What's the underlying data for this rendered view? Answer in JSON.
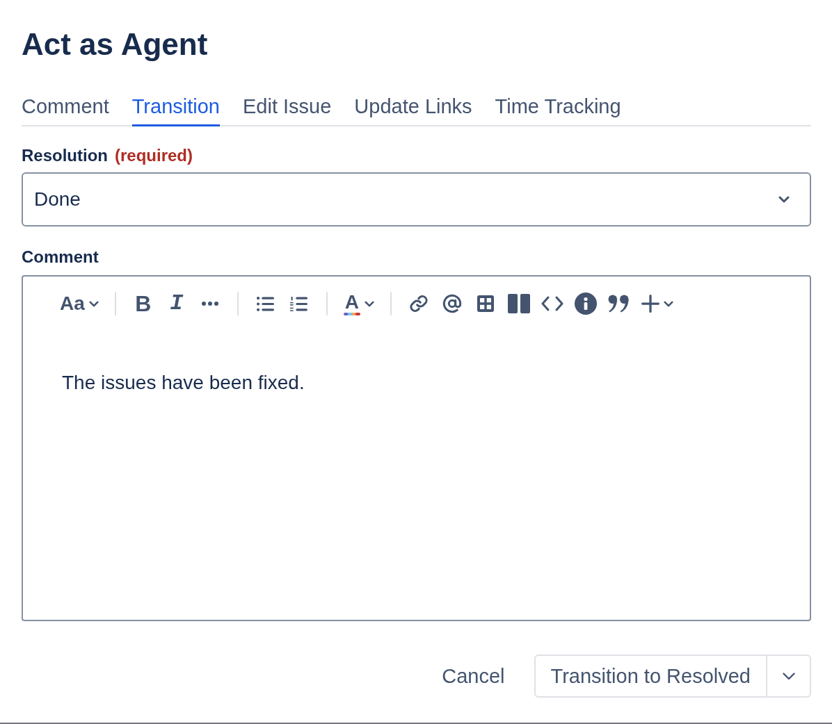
{
  "dialog": {
    "title": "Act as Agent"
  },
  "tabs": [
    {
      "label": "Comment",
      "selected": false
    },
    {
      "label": "Transition",
      "selected": true
    },
    {
      "label": "Edit Issue",
      "selected": false
    },
    {
      "label": "Update Links",
      "selected": false
    },
    {
      "label": "Time Tracking",
      "selected": false
    }
  ],
  "resolution": {
    "label": "Resolution",
    "required_note": "(required)",
    "value": "Done"
  },
  "comment": {
    "label": "Comment",
    "toolbar_groups": [
      {
        "items": [
          {
            "kind": "text-style",
            "label": "Aa",
            "dropdown": true
          }
        ]
      },
      {
        "items": [
          {
            "kind": "bold",
            "label": "B"
          },
          {
            "kind": "italic",
            "label": "I"
          },
          {
            "kind": "more"
          }
        ]
      },
      {
        "items": [
          {
            "kind": "bullet-list"
          },
          {
            "kind": "numbered-list"
          }
        ]
      },
      {
        "items": [
          {
            "kind": "text-color",
            "label": "A",
            "dropdown": true
          }
        ]
      },
      {
        "items": [
          {
            "kind": "link"
          },
          {
            "kind": "mention"
          },
          {
            "kind": "table"
          },
          {
            "kind": "layout"
          },
          {
            "kind": "code"
          },
          {
            "kind": "info"
          },
          {
            "kind": "quote"
          },
          {
            "kind": "insert",
            "dropdown": true
          }
        ]
      }
    ],
    "text": "The issues have been fixed."
  },
  "footer": {
    "cancel": "Cancel",
    "submit": "Transition to Resolved"
  }
}
